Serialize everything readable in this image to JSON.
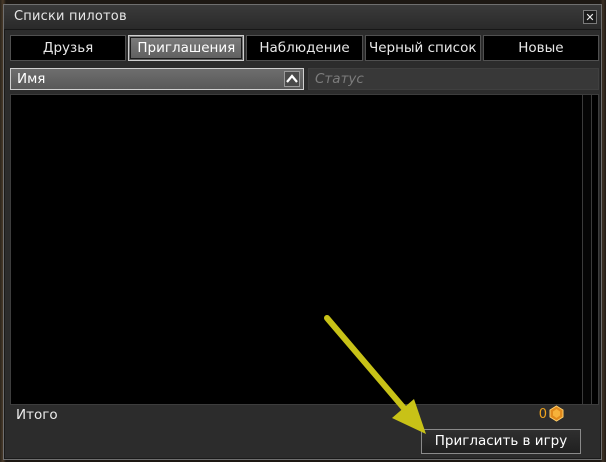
{
  "window": {
    "title": "Списки пилотов",
    "close_label": "✕"
  },
  "tabs": [
    {
      "label": "Друзья",
      "active": false
    },
    {
      "label": "Приглашения",
      "active": true
    },
    {
      "label": "Наблюдение",
      "active": false
    },
    {
      "label": "Черный список",
      "active": false
    },
    {
      "label": "Новые",
      "active": false
    }
  ],
  "columns": {
    "name": "Имя",
    "status": "Статус",
    "sort_icon": "chevron-up-icon"
  },
  "footer": {
    "total_label": "Итого",
    "count": "0",
    "currency_icon": "gold-coin-icon",
    "invite_button": "Пригласить в игру"
  },
  "annotation": {
    "arrow_icon": "arrow-pointer-icon",
    "color": "#c8c217"
  },
  "colors": {
    "accent_orange": "#f0a41e",
    "list_background": "#000000",
    "panel_background": "#2c2c2c"
  }
}
